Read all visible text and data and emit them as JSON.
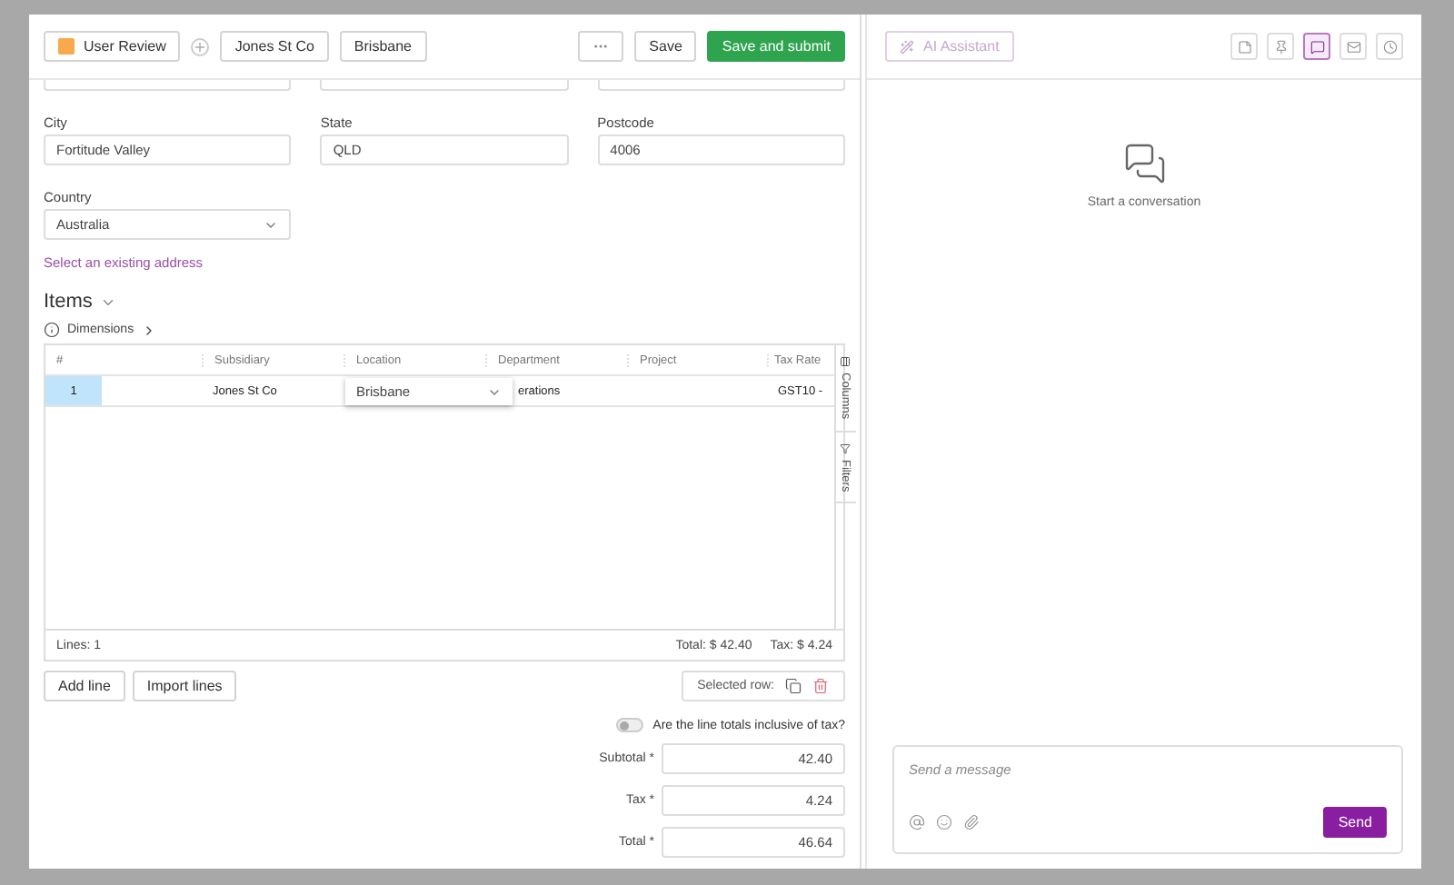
{
  "header": {
    "status": {
      "label": "User Review",
      "color": "#f7a94c"
    },
    "tags": [
      "Jones St Co",
      "Brisbane"
    ],
    "save": "Save",
    "submit": "Save and submit"
  },
  "address": {
    "fields": [
      {
        "label": "City",
        "value": "Fortitude Valley"
      },
      {
        "label": "State",
        "value": "QLD"
      },
      {
        "label": "Postcode",
        "value": "4006"
      }
    ],
    "country": {
      "label": "Country",
      "value": "Australia"
    },
    "link": "Select an existing address"
  },
  "items": {
    "title": "Items",
    "dimensions": "Dimensions",
    "columns": [
      "#",
      "Subsidiary",
      "Location",
      "Department",
      "Project",
      "Tax Rate"
    ],
    "rows": [
      {
        "number": "1",
        "subsidiary": "Jones St Co",
        "location": "Brisbane",
        "department": "erations",
        "tax_rate": "GST10 -",
        "selected": true
      }
    ],
    "side_tabs": [
      "Columns",
      "Filters"
    ],
    "footer": {
      "lines": "Lines: 1",
      "total": "Total: $ 42.40",
      "tax": "Tax: $ 4.24"
    }
  },
  "actions": {
    "add": "Add line",
    "import": "Import lines",
    "selected_row": "Selected row:"
  },
  "toggle": {
    "label": "Are the line totals inclusive of tax?",
    "on": false
  },
  "totals": [
    {
      "label": "Subtotal *",
      "value": "42.40"
    },
    {
      "label": "Tax *",
      "value": "4.24"
    },
    {
      "label": "Total *",
      "value": "46.64"
    }
  ],
  "assistant": {
    "ai_button": {
      "label": "AI Assistant",
      "disabled": true
    },
    "tools": [
      {
        "kind": "note",
        "selected": false
      },
      {
        "kind": "pin",
        "selected": false
      },
      {
        "kind": "chat",
        "selected": true
      },
      {
        "kind": "mail",
        "selected": false
      },
      {
        "kind": "clock",
        "selected": false
      }
    ],
    "empty_text": "Start a conversation",
    "composer": {
      "placeholder": "Send a message",
      "send": "Send"
    }
  }
}
